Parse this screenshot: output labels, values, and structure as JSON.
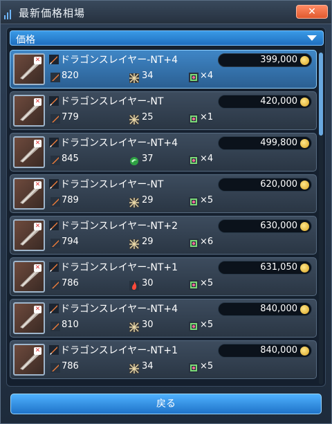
{
  "window": {
    "title": "最新価格相場",
    "close_label": "✕"
  },
  "sort": {
    "label": "価格"
  },
  "colors": {
    "accent": "#2b8ee0",
    "selected_row": "#3f86c6",
    "row_bg": "#34414f"
  },
  "rows": [
    {
      "name": "ドラゴンスレイヤー-NT+4",
      "price": "399,000",
      "attack": "820",
      "affix_icon": "mixed-element-icon",
      "affix": "34",
      "slots": "×4",
      "selected": true
    },
    {
      "name": "ドラゴンスレイヤー-NT",
      "price": "420,000",
      "attack": "779",
      "affix_icon": "mixed-element-icon",
      "affix": "25",
      "slots": "×1",
      "selected": false
    },
    {
      "name": "ドラゴンスレイヤー-NT+4",
      "price": "499,800",
      "attack": "845",
      "affix_icon": "wind-element-icon",
      "affix": "37",
      "slots": "×4",
      "selected": false
    },
    {
      "name": "ドラゴンスレイヤー-NT",
      "price": "620,000",
      "attack": "789",
      "affix_icon": "mixed-element-icon",
      "affix": "29",
      "slots": "×5",
      "selected": false
    },
    {
      "name": "ドラゴンスレイヤー-NT+2",
      "price": "630,000",
      "attack": "794",
      "affix_icon": "mixed-element-icon",
      "affix": "29",
      "slots": "×6",
      "selected": false
    },
    {
      "name": "ドラゴンスレイヤー-NT+1",
      "price": "631,050",
      "attack": "786",
      "affix_icon": "fire-element-icon",
      "affix": "30",
      "slots": "×5",
      "selected": false
    },
    {
      "name": "ドラゴンスレイヤー-NT+4",
      "price": "840,000",
      "attack": "810",
      "affix_icon": "mixed-element-icon",
      "affix": "30",
      "slots": "×5",
      "selected": false
    },
    {
      "name": "ドラゴンスレイヤー-NT+1",
      "price": "840,000",
      "attack": "786",
      "affix_icon": "mixed-element-icon",
      "affix": "34",
      "slots": "×5",
      "selected": false
    }
  ],
  "footer": {
    "back_label": "戻る"
  }
}
